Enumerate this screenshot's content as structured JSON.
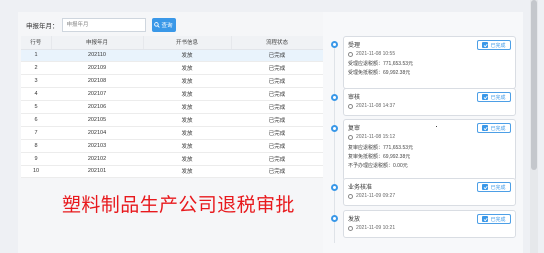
{
  "search": {
    "label": "申报年月：",
    "placeholder": "申报年月",
    "button": "查询"
  },
  "table": {
    "headers": [
      "行号",
      "申报年月",
      "开书信息",
      "流程状态"
    ],
    "rows": [
      [
        "1",
        "202110",
        "发放",
        "已完成"
      ],
      [
        "2",
        "202109",
        "发放",
        "已完成"
      ],
      [
        "3",
        "202108",
        "发放",
        "已完成"
      ],
      [
        "4",
        "202107",
        "发放",
        "已完成"
      ],
      [
        "5",
        "202106",
        "发放",
        "已完成"
      ],
      [
        "6",
        "202105",
        "发放",
        "已完成"
      ],
      [
        "7",
        "202104",
        "发放",
        "已完成"
      ],
      [
        "8",
        "202103",
        "发放",
        "已完成"
      ],
      [
        "9",
        "202102",
        "发放",
        "已完成"
      ],
      [
        "10",
        "202101",
        "发放",
        "已完成"
      ]
    ]
  },
  "watermark": "塑料制品生产公司退税审批",
  "timeline": [
    {
      "title": "受理",
      "status": "已完成",
      "time": "2021-11-08 10:55",
      "lines": [
        "受理应退税额：771,653.53元",
        "受理免抵税额：69,992.38元"
      ]
    },
    {
      "title": "审核",
      "status": "已完成",
      "time": "2021-11-08 14:37",
      "lines": []
    },
    {
      "title": "复审",
      "status": "已完成",
      "time": "2021-11-08 15:12",
      "lines": [
        "复审应退税额：771,653.53元",
        "复审免抵税额：69,992.38元",
        "不予办理应退税额：0.00元"
      ]
    },
    {
      "title": "业务核准",
      "status": "已完成",
      "time": "2021-11-09 09:27",
      "lines": []
    },
    {
      "title": "发放",
      "status": "已完成",
      "time": "2021-11-09 10:21",
      "lines": []
    }
  ],
  "colors": {
    "accent": "#3a98e8",
    "watermark": "#e8191d",
    "selected_row": "#e9f3fc"
  },
  "icons": {
    "search": "search-icon",
    "check": "check-icon",
    "clock": "clock-icon"
  }
}
